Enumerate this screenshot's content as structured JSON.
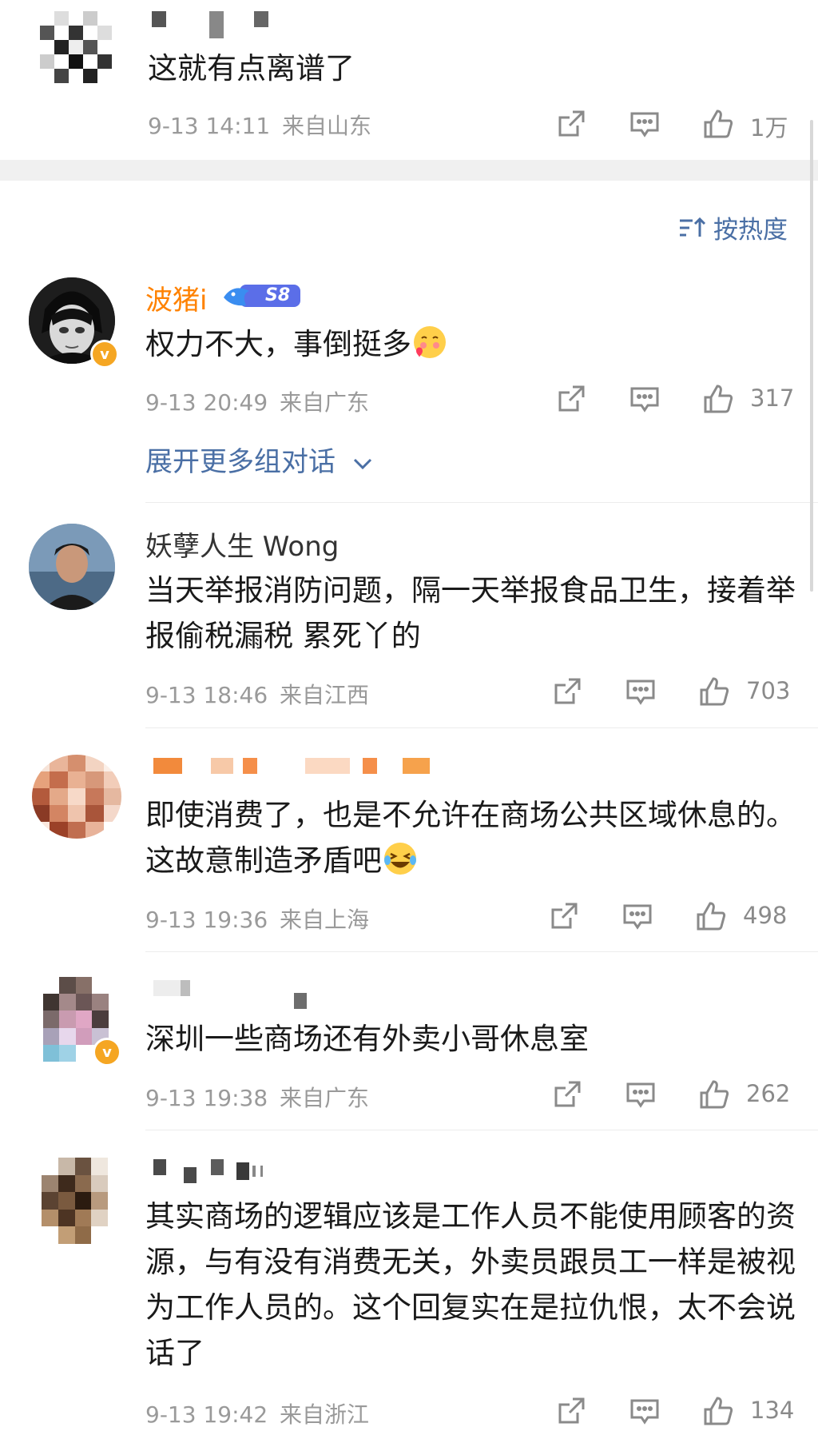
{
  "top_comment": {
    "text": "这就有点离谱了",
    "time": "9-13 14:11",
    "location": "来自山东",
    "likes": "1万"
  },
  "sort": {
    "label": "按热度",
    "icon": "sort-icon"
  },
  "comments": [
    {
      "name": "波猪i",
      "badge_text": "S8",
      "text": "权力不大，事倒挺多",
      "time": "9-13 20:49",
      "location": "来自广东",
      "likes": "317",
      "expand_label": "展开更多组对话"
    },
    {
      "name": "妖孽人生 Wong",
      "text": "当天举报消防问题，隔一天举报食品卫生，接着举报偷税漏税  累死丫的",
      "time": "9-13 18:46",
      "location": "来自江西",
      "likes": "703"
    },
    {
      "text": "即使消费了，也是不允许在商场公共区域休息的。这故意制造矛盾吧",
      "time": "9-13 19:36",
      "location": "来自上海",
      "likes": "498"
    },
    {
      "text": "深圳一些商场还有外卖小哥休息室",
      "time": "9-13 19:38",
      "location": "来自广东",
      "likes": "262"
    },
    {
      "text": "其实商场的逻辑应该是工作人员不能使用顾客的资源，与有没有消费无关，外卖员跟员工一样是被视为工作人员的。这个回复实在是拉仇恨，太不会说话了",
      "time": "9-13 19:42",
      "location": "来自浙江",
      "likes": "134"
    }
  ],
  "colors": {
    "accent_link": "#4a6fa5",
    "name_highlight": "#ff8200",
    "verified_badge": "#f5a623",
    "meta_gray": "#9a9a9a"
  }
}
